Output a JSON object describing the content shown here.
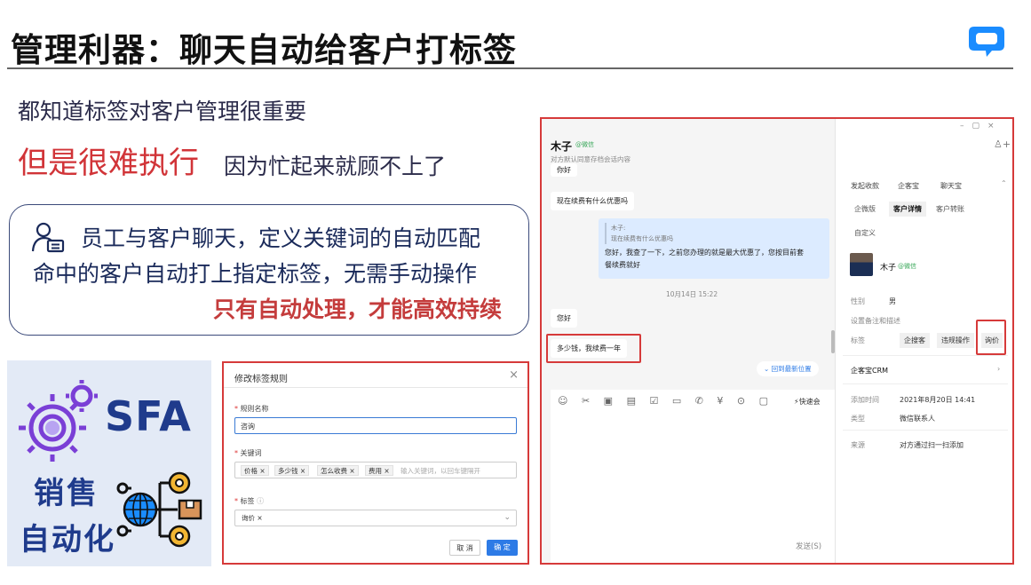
{
  "slide": {
    "title": "管理利器：聊天自动给客户打标签",
    "line1": "都知道标签对客户管理很重要",
    "line2_red": "但是很难执行",
    "line2_rest": "因为忙起来就顾不上了",
    "card": {
      "l1": "员工与客户聊天，定义关键词的自动匹配",
      "l2": "命中的客户自动打上指定标签，无需手动操作",
      "l3": "只有自动处理，才能高效持续"
    },
    "sfa": {
      "big": "SFA",
      "c1": "销售",
      "c2": "自动化"
    },
    "colors": {
      "accent_red": "#d13438",
      "navy": "#1f3b8c",
      "brand_blue": "#1a8cff"
    }
  },
  "dialog": {
    "title": "修改标签规则",
    "rule_label": "规则名称",
    "rule_value": "咨询",
    "kw_label": "关键词",
    "keywords": [
      "价格",
      "多少钱",
      "怎么收费",
      "费用"
    ],
    "kw_placeholder": "输入关键词，以回车键隔开",
    "tag_label": "标签",
    "tag_value": "询价",
    "cancel": "取 消",
    "confirm": "确 定"
  },
  "chat": {
    "name": "木子",
    "source": "@微信",
    "subtitle": "对方默认同意存档会话内容",
    "msgs": {
      "m0": "你好",
      "m1": "现在续费有什么优惠吗",
      "quote_name": "木子:",
      "quote_text": "现在续费有什么优惠吗",
      "reply1": "您好，我查了一下，之前您办理的就是最大优惠了，您按目前套",
      "reply2": "餐续费就好",
      "time": "10月14日 15:22",
      "m2": "您好",
      "m3": "多少钱，我续费一年"
    },
    "new_pos": "回到最新位置",
    "quick": "快速会",
    "send": "发送(S)",
    "right": {
      "tabs1": [
        "发起收款",
        "企客宝",
        "聊天宝"
      ],
      "tabs2": [
        "企微版",
        "客户详情",
        "客户转账"
      ],
      "custom": "自定义",
      "name": "木子",
      "source": "@微信",
      "gender_k": "性别",
      "gender_v": "男",
      "remark": "设置备注和描述",
      "tag_k": "标签",
      "tags": [
        "企搜客",
        "违规操作",
        "询价"
      ],
      "crm": "企客宝CRM",
      "add_time_k": "添加时间",
      "add_time_v": "2021年8月20日 14:41",
      "type_k": "类型",
      "type_v": "微信联系人",
      "src_k": "来源",
      "src_v": "对方通过扫一扫添加"
    }
  }
}
